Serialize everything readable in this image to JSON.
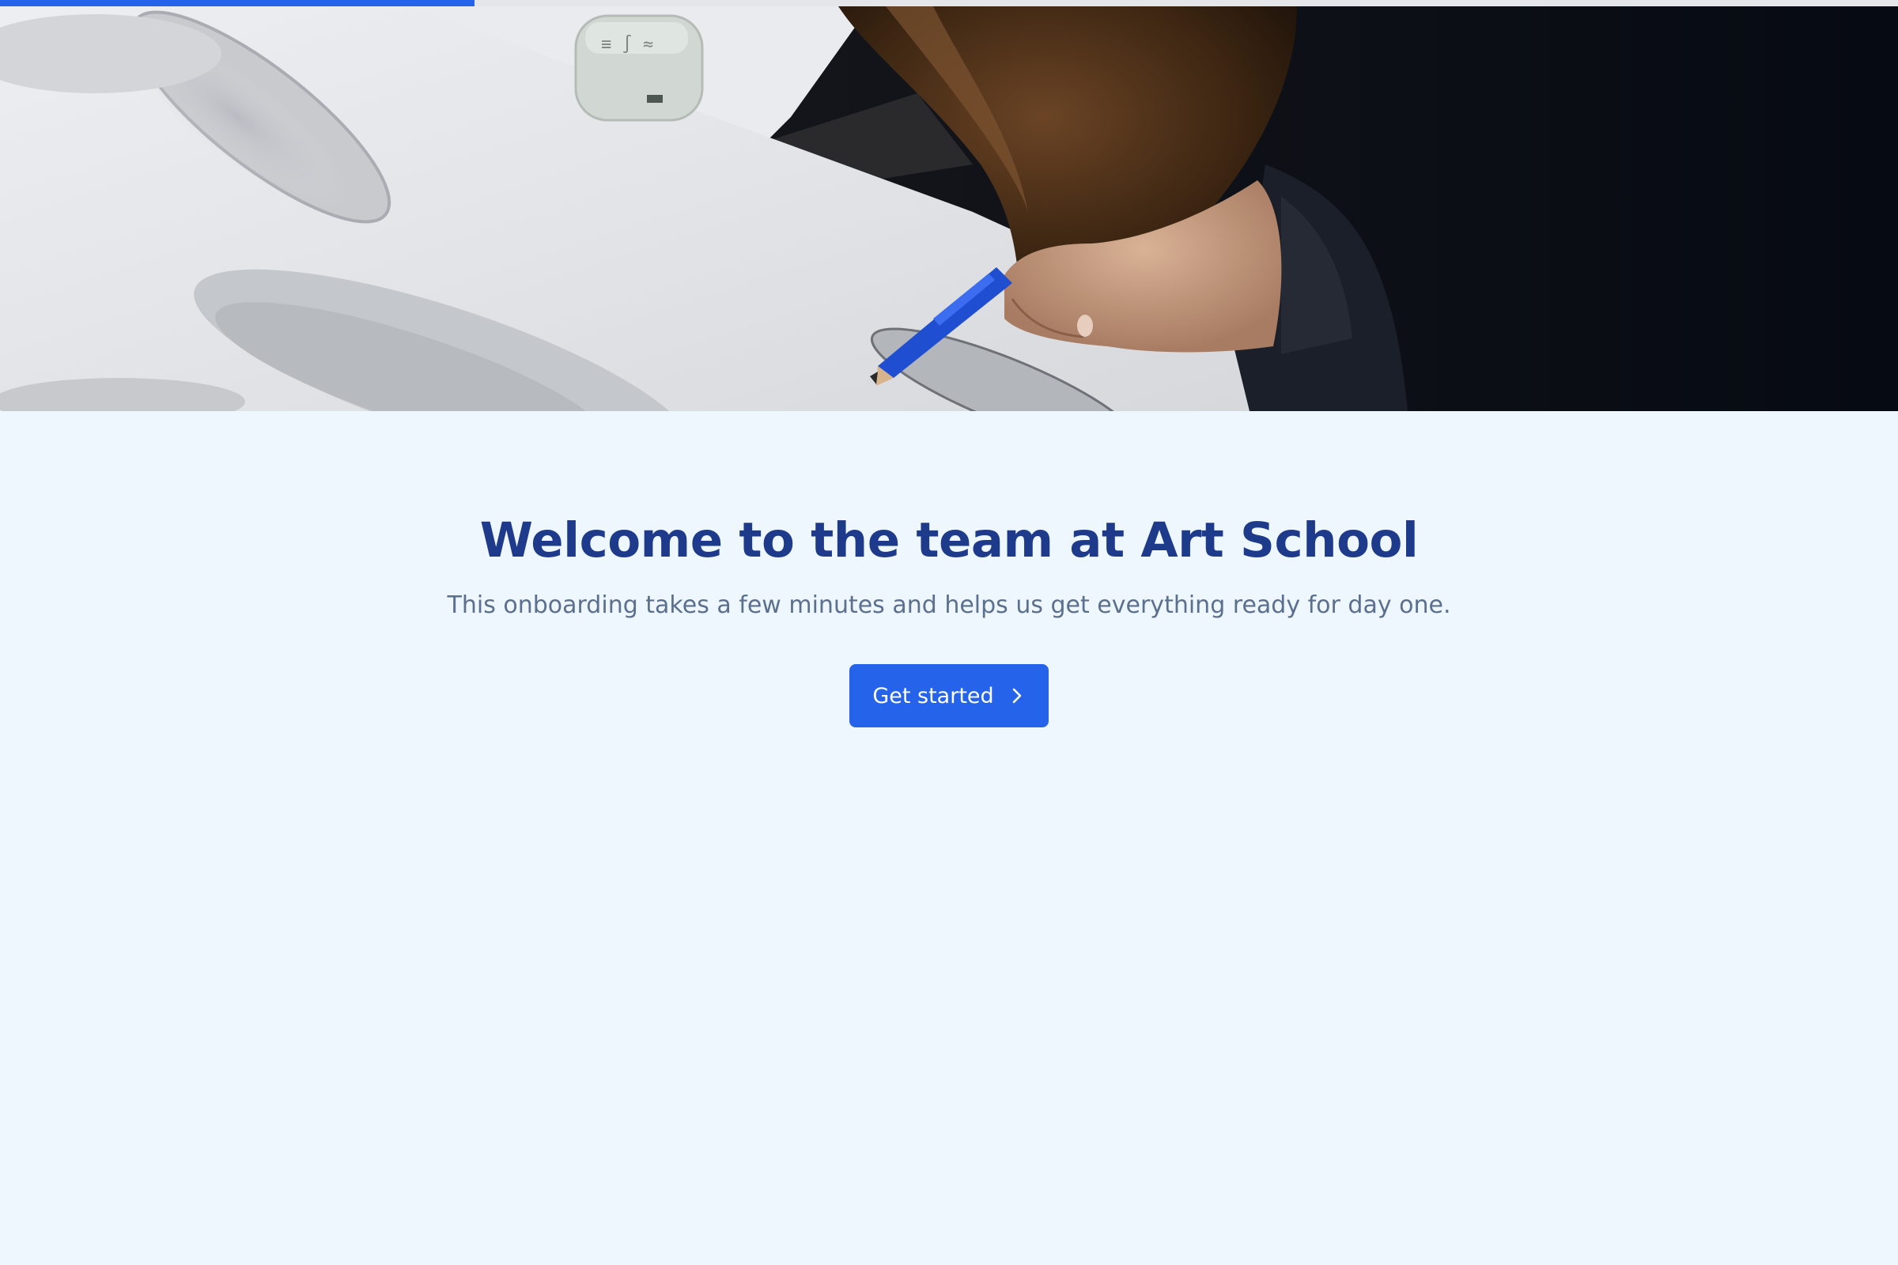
{
  "onboarding": {
    "progress_fraction": 0.25,
    "title": "Welcome to the team at Art School",
    "subtitle": "This onboarding takes a few minutes and helps us get everything ready for day one.",
    "cta_label": "Get started",
    "cta_icon": "chevron-right-icon"
  },
  "colors": {
    "accent": "#2563eb",
    "title": "#1e3a8a",
    "subtitle": "#5b6f8f",
    "background": "#eef6fe"
  }
}
